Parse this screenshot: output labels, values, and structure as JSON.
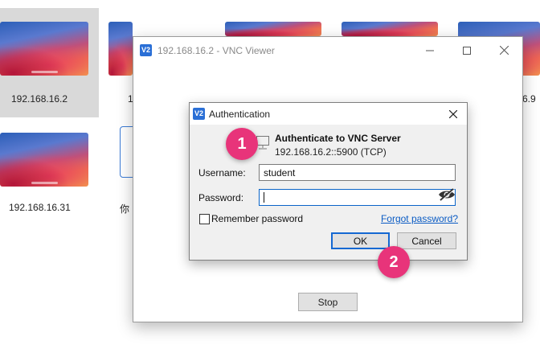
{
  "background_hosts": {
    "tiles": [
      {
        "label": "192.168.16.2"
      },
      {
        "label": "1"
      },
      {
        "label": ""
      },
      {
        "label": ""
      },
      {
        "label": "6.9"
      },
      {
        "label": "192.168.16.31"
      },
      {
        "label": "你"
      }
    ]
  },
  "viewer": {
    "icon": "V2",
    "title": "192.168.16.2 - VNC Viewer",
    "stop_label": "Stop"
  },
  "auth_dialog": {
    "icon": "V2",
    "title": "Authentication",
    "heading": "Authenticate to VNC Server",
    "server_address": "192.168.16.2::5900 (TCP)",
    "username_label": "Username:",
    "username_value": "student",
    "password_label": "Password:",
    "password_value": "",
    "remember_label": "Remember password",
    "remember_checked": false,
    "forgot_label": "Forgot password?",
    "ok_label": "OK",
    "cancel_label": "Cancel"
  },
  "callouts": [
    {
      "number": "1"
    },
    {
      "number": "2"
    }
  ],
  "colors": {
    "accent": "#1468d2",
    "callout": "#e8347a",
    "link": "#0b5cc4"
  }
}
